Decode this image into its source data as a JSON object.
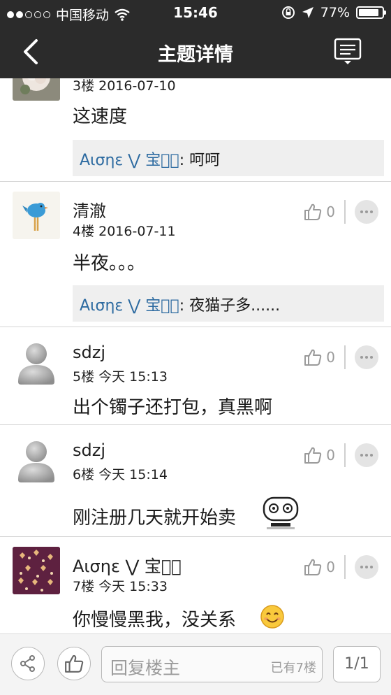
{
  "status_bar": {
    "carrier": "中国移动",
    "time": "15:46",
    "battery": "77%"
  },
  "nav": {
    "title": "主题详情"
  },
  "posts": [
    {
      "floor_date": "3楼 2016-07-10",
      "content": "这速度",
      "quote_name": "Aισηε ⋁ 宝儿᷃",
      "quote_text": ": 呵呵"
    },
    {
      "username": "清澈",
      "floor_date": "4楼 2016-07-11",
      "likes": "0",
      "content": "半夜。。。",
      "quote_name": "Aισηε ⋁ 宝儿᷃",
      "quote_text": ": 夜猫子多......"
    },
    {
      "username": "sdzj",
      "floor_date": "5楼 今天 15:13",
      "likes": "0",
      "content": "出个镯子还打包，真黑啊"
    },
    {
      "username": "sdzj",
      "floor_date": "6楼 今天 15:14",
      "likes": "0",
      "content": "刚注册几天就开始卖"
    },
    {
      "username": "Aισηε ⋁ 宝儿᷃",
      "floor_date": "7楼 今天 15:33",
      "likes": "0",
      "content": "你慢慢黑我，没关系"
    }
  ],
  "bottom_bar": {
    "reply_placeholder": "回复楼主",
    "reply_count": "已有7楼",
    "page": "1/1"
  },
  "colors": {
    "header_bg": "#2b2b2b",
    "quote_name": "#2c6aa0",
    "quote_bg": "#efefef"
  },
  "icons": [
    "back-arrow-icon",
    "list-menu-icon",
    "thumbs-up-icon",
    "more-dots-icon",
    "share-icon",
    "wifi-icon",
    "location-icon",
    "lock-rotation-icon",
    "battery-icon"
  ]
}
